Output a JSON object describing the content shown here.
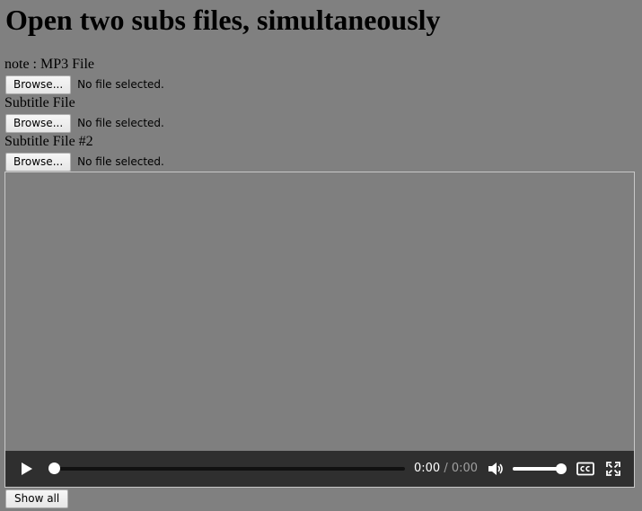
{
  "page": {
    "title": "Open two subs files, simultaneously"
  },
  "inputs": [
    {
      "label": "note : MP3 File",
      "button_label": "Browse...",
      "status": "No file selected."
    },
    {
      "label": "Subtitle File",
      "button_label": "Browse...",
      "status": "No file selected."
    },
    {
      "label": "Subtitle File #2",
      "button_label": "Browse...",
      "status": "No file selected."
    }
  ],
  "player": {
    "current_time": "0:00",
    "separator": "/",
    "duration": "0:00",
    "progress": 0,
    "volume": 1.0,
    "icons": {
      "play": "play-icon",
      "volume": "volume-icon",
      "captions": "closed-captions-icon",
      "fullscreen": "fullscreen-icon"
    }
  },
  "actions": {
    "show_all_label": "Show all"
  }
}
